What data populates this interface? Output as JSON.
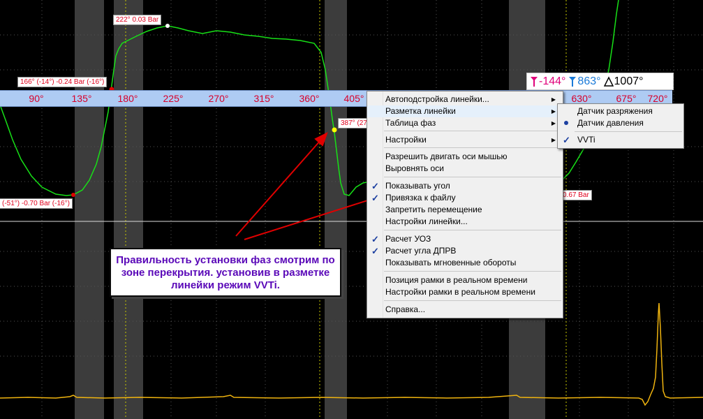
{
  "ruler": {
    "ticks": [
      "90°",
      "135°",
      "180°",
      "225°",
      "270°",
      "315°",
      "360°",
      "405°",
      "630°",
      "675°",
      "720°"
    ]
  },
  "cursor_info": {
    "cursor_a": "-144°",
    "cursor_b": "863°",
    "delta": "1007°"
  },
  "point_labels": {
    "max": "222° 0.03 Bar",
    "rise": "166° (-14°) -0.24 Bar (-16°)",
    "min": "(-51°) -0.70 Bar (-16°)",
    "fall": "387° (27",
    "right": "0.67 Bar"
  },
  "context_menu": {
    "items": [
      {
        "label": "Автоподстройка линейки...",
        "submenu": true
      },
      {
        "label": "Разметка линейки",
        "submenu": true,
        "highlighted": true
      },
      {
        "label": "Таблица фаз",
        "submenu": true
      },
      {
        "label": "Настройки",
        "submenu": true
      },
      {
        "label": "Разрешить двигать оси мышью"
      },
      {
        "label": "Выровнять оси"
      },
      {
        "label": "Показывать угол",
        "checked": true
      },
      {
        "label": "Привязка к файлу",
        "checked": true
      },
      {
        "label": "Запретить перемещение"
      },
      {
        "label": "Настройки линейки..."
      },
      {
        "label": "Расчет УОЗ",
        "checked": true
      },
      {
        "label": "Расчет угла ДПРВ",
        "checked": true
      },
      {
        "label": "Показывать мгновенные обороты"
      },
      {
        "label": "Позиция рамки в реальном времени"
      },
      {
        "label": "Настройки рамки в реальном времени"
      },
      {
        "label": "Справка..."
      }
    ]
  },
  "submenu": {
    "items": [
      {
        "label": "Датчик разряжения",
        "mark": ""
      },
      {
        "label": "Датчик давления",
        "mark": "dot"
      },
      {
        "label": "VVTi",
        "mark": "check"
      }
    ]
  },
  "note": {
    "text": "Правильность установки фаз смотрим по зоне перекрытия. установив в разметке линейки режим VVTi."
  },
  "colors": {
    "pressure_trace": "#17e017",
    "sync_trace": "#f0b40f",
    "ruler_bg": "#aecbf3",
    "ruler_text": "#d8002a",
    "annotation_text": "#5a08b8",
    "arrow": "#e00000"
  }
}
